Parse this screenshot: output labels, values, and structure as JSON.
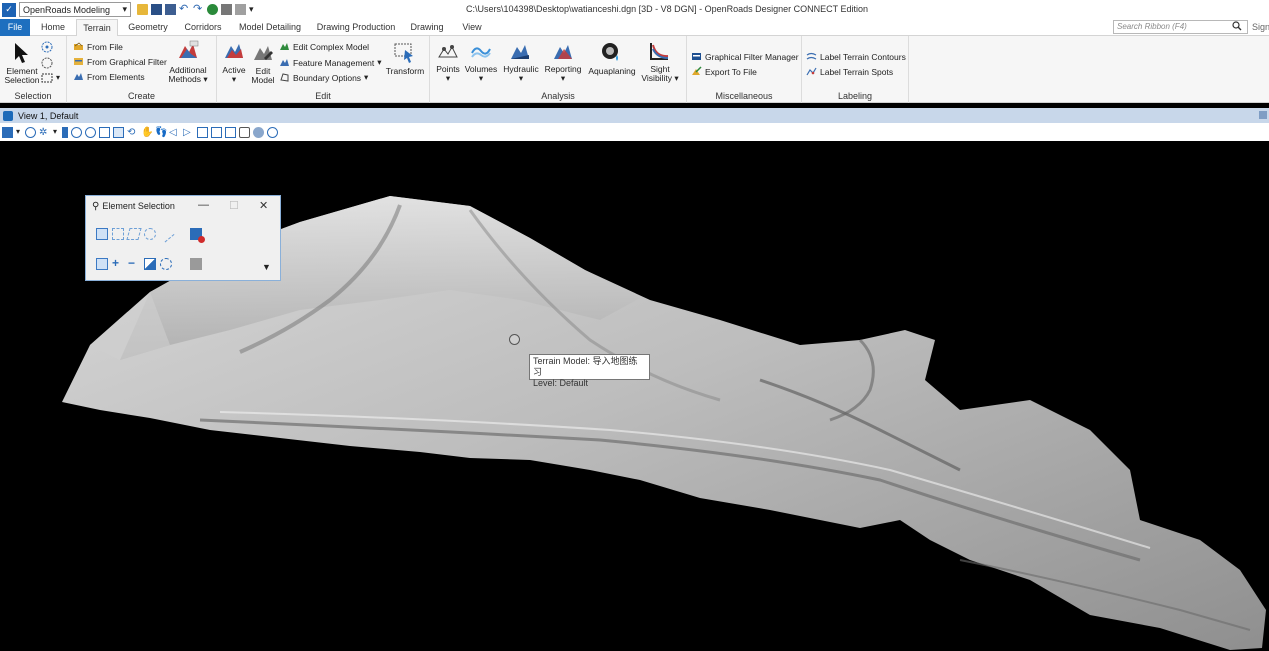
{
  "titlebar": {
    "workspace": "OpenRoads Modeling",
    "title": "C:\\Users\\104398\\Desktop\\watianceshi.dgn [3D - V8 DGN] - OpenRoads Designer CONNECT Edition"
  },
  "tabs": [
    "File",
    "Home",
    "Terrain",
    "Geometry",
    "Corridors",
    "Model Detailing",
    "Drawing Production",
    "Drawing",
    "View"
  ],
  "active_tab": "Terrain",
  "search": {
    "placeholder": "Search Ribbon (F4)"
  },
  "sign_label": "Sign",
  "ribbon": {
    "selection": {
      "label": "Selection",
      "element_selection": "Element Selection"
    },
    "create": {
      "label": "Create",
      "from_file": "From File",
      "from_graphical_filter": "From Graphical Filter",
      "from_elements": "From Elements",
      "additional_methods_1": "Additional",
      "additional_methods_2": "Methods"
    },
    "edit": {
      "label": "Edit",
      "active": "Active",
      "edit_model_1": "Edit",
      "edit_model_2": "Model",
      "edit_complex_model": "Edit Complex Model",
      "feature_management": "Feature Management",
      "boundary_options": "Boundary Options",
      "transform": "Transform"
    },
    "analysis": {
      "label": "Analysis",
      "points": "Points",
      "volumes": "Volumes",
      "hydraulic": "Hydraulic",
      "reporting": "Reporting",
      "aquaplaning": "Aquaplaning",
      "sight_1": "Sight",
      "sight_2": "Visibility"
    },
    "misc": {
      "label": "Miscellaneous",
      "graphical_filter_manager": "Graphical Filter Manager",
      "export_to_file": "Export To File"
    },
    "labeling": {
      "label": "Labeling",
      "label_terrain_contours": "Label Terrain Contours",
      "label_terrain_spots": "Label Terrain Spots"
    }
  },
  "view": {
    "title": "View 1, Default"
  },
  "dialog": {
    "title": "Element Selection"
  },
  "tooltip": {
    "line1": "Terrain Model: 导入地图练习",
    "line2": "Level: Default"
  },
  "colors": {
    "ribbon_bg": "#f6f6f6",
    "accent": "#1e6fbf",
    "viewport_bg": "#000000",
    "viewbar_bg": "#c8d7ea"
  }
}
